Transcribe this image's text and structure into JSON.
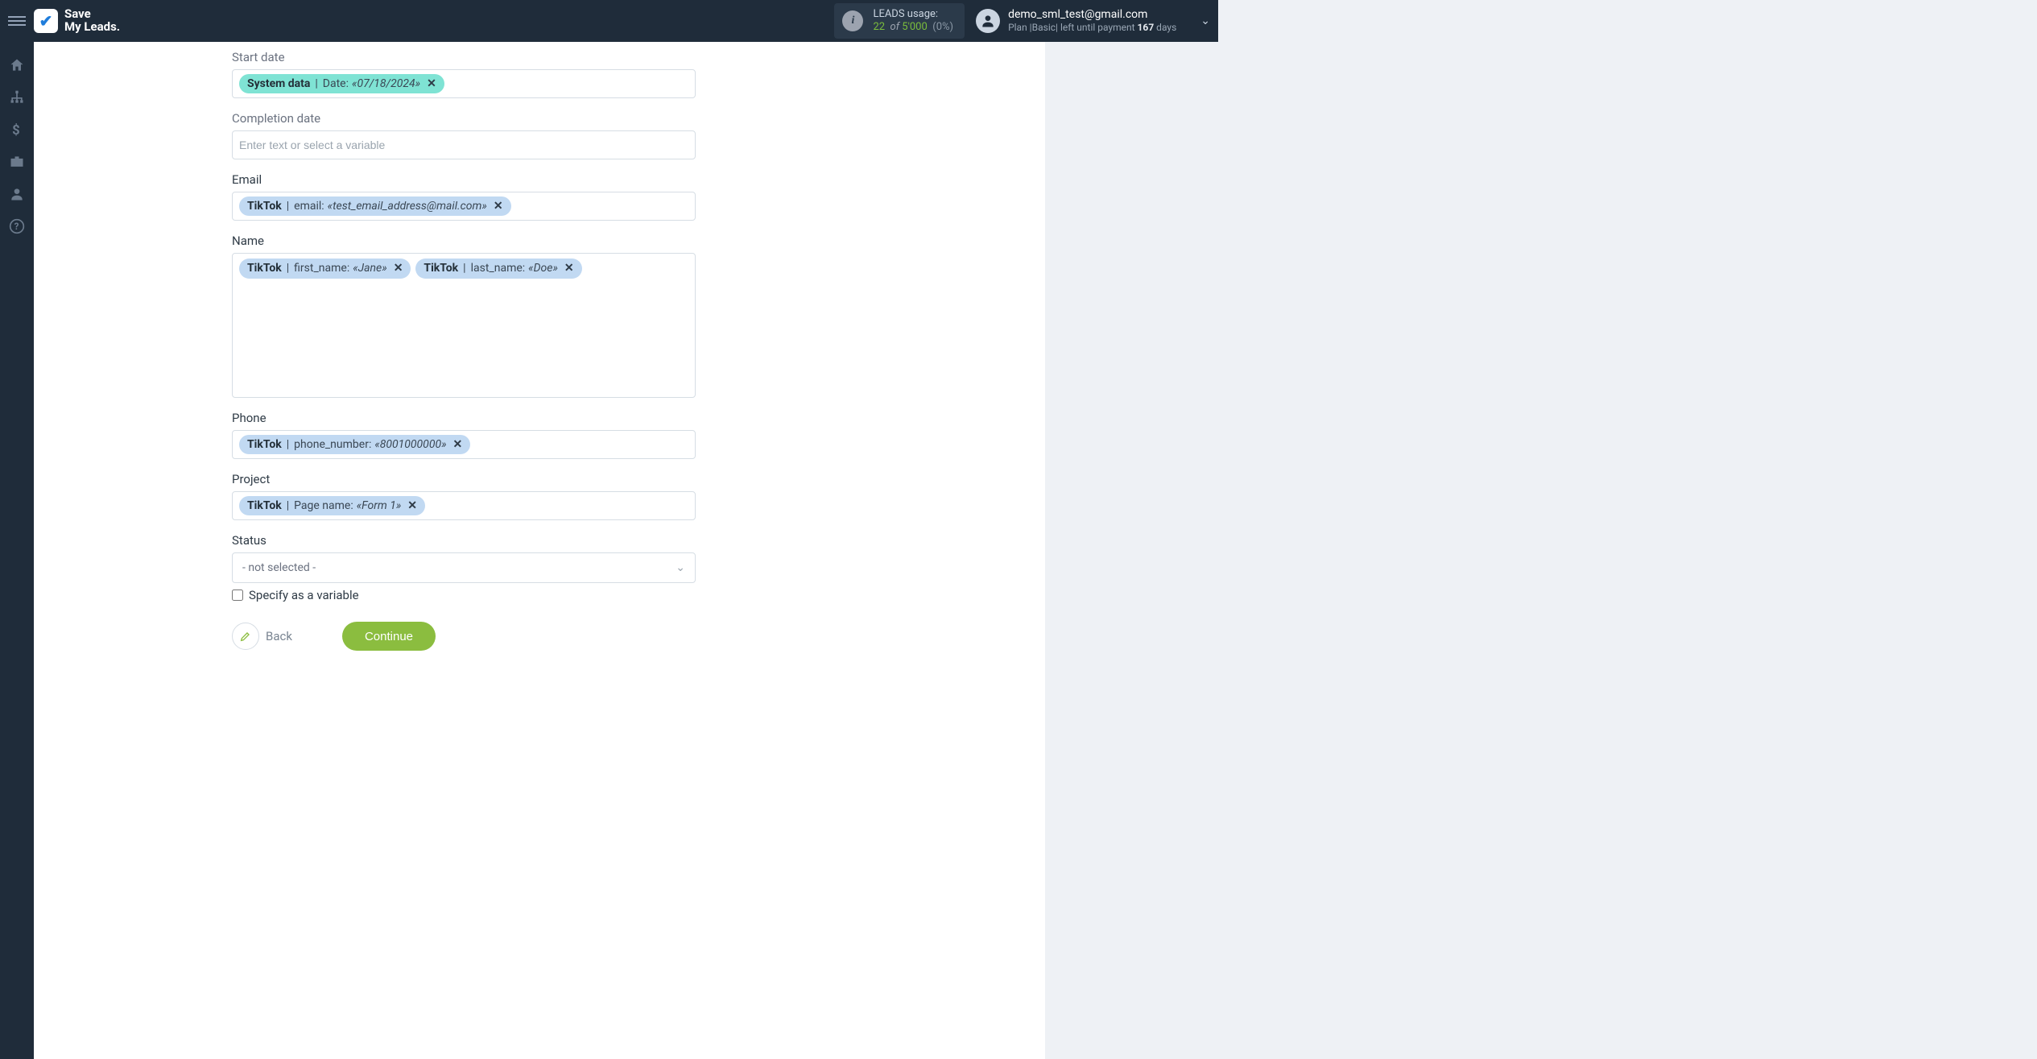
{
  "brand": {
    "line1": "Save",
    "line2": "My Leads."
  },
  "usage": {
    "label": "LEADS usage:",
    "count": "22",
    "of": "of",
    "limit": "5'000",
    "percent": "(0%)"
  },
  "user": {
    "email": "demo_sml_test@gmail.com",
    "plan_prefix": "Plan |",
    "plan_name": "Basic",
    "plan_mid": "| left until payment ",
    "days": "167",
    "plan_suffix": " days"
  },
  "form": {
    "start_date": {
      "label": "Start date",
      "chip": {
        "source": "System data",
        "field": "Date:",
        "value": "«07/18/2024»"
      }
    },
    "completion_date": {
      "label": "Completion date",
      "placeholder": "Enter text or select a variable"
    },
    "email": {
      "label": "Email",
      "chip": {
        "source": "TikTok",
        "field": "email:",
        "value": "«test_email_address@mail.com»"
      }
    },
    "name": {
      "label": "Name",
      "chips": [
        {
          "source": "TikTok",
          "field": "first_name:",
          "value": "«Jane»"
        },
        {
          "source": "TikTok",
          "field": "last_name:",
          "value": "«Doe»"
        }
      ]
    },
    "phone": {
      "label": "Phone",
      "chip": {
        "source": "TikTok",
        "field": "phone_number:",
        "value": "«8001000000»"
      }
    },
    "project": {
      "label": "Project",
      "chip": {
        "source": "TikTok",
        "field": "Page name:",
        "value": "«Form 1»"
      }
    },
    "status": {
      "label": "Status",
      "selected": "- not selected -",
      "specify_label": "Specify as a variable"
    },
    "actions": {
      "back": "Back",
      "continue": "Continue"
    }
  }
}
